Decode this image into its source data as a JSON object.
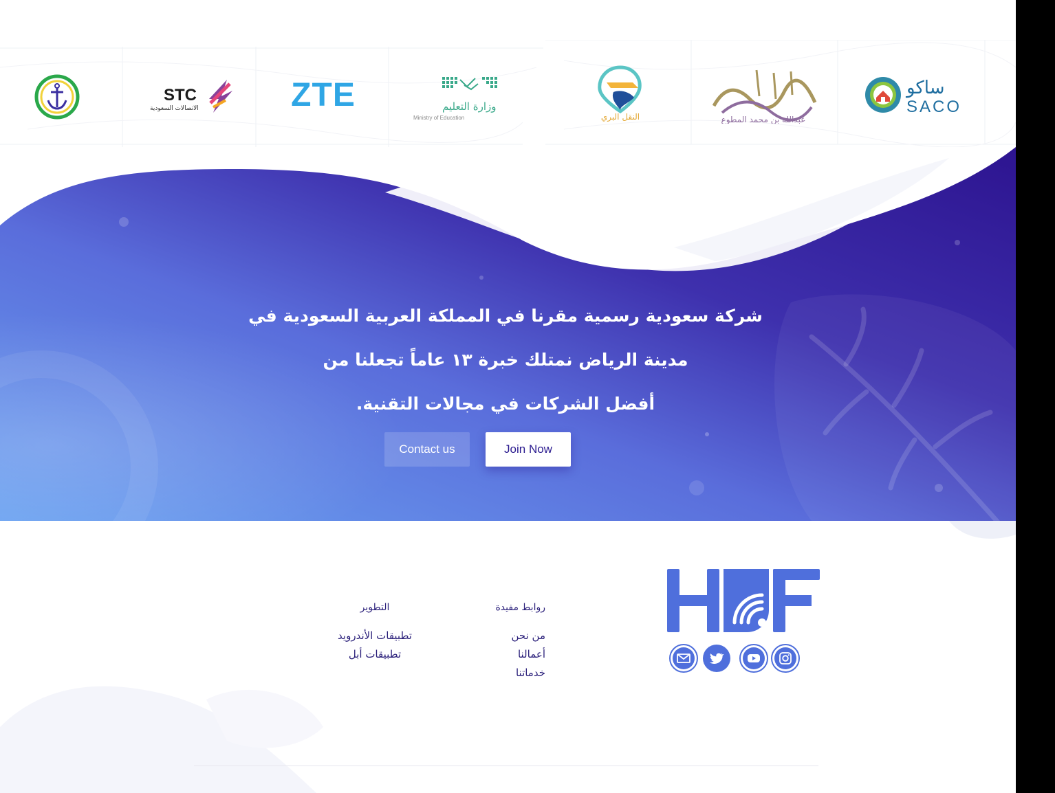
{
  "partners": {
    "logos": [
      {
        "name": "saco",
        "text_ar": "ساكو",
        "text_en": "SACO"
      },
      {
        "name": "abdullah-almutawa",
        "text_ar": "عبدالله بن محمد المطوع"
      },
      {
        "name": "land-transport",
        "text_ar": "النقل البري"
      },
      {
        "name": "ministry-of-education",
        "text_ar": "وزارة التعليم",
        "text_en": "Ministry of Education"
      },
      {
        "name": "zte",
        "text_en": "ZTE"
      },
      {
        "name": "stc",
        "text_en": "STC",
        "text_ar": "الاتصالات السعودية"
      },
      {
        "name": "maritime-anchor"
      }
    ]
  },
  "hero": {
    "line1": "شركة سعودية رسمية مقرنا في المملكة العربية السعودية في",
    "line2": "مدينة الرياض نمتلك خبرة ١٣ عاماً تجعلنا من",
    "line3": "أفضل الشركات في مجالات التقنية.",
    "contact_label": "Contact us",
    "join_label": "Join Now"
  },
  "footer": {
    "links_heading": "روابط مفيدة",
    "links": [
      "من نحن",
      "أعمالنا",
      "خدماتنا"
    ],
    "dev_heading": "التطوير",
    "dev_links": [
      "تطبيقات الأندرويد",
      "تطبيقات أبل"
    ],
    "brand_logo": "HCF",
    "social_icons": [
      "instagram-icon",
      "youtube-icon",
      "twitter-icon",
      "mail-icon"
    ]
  },
  "colors": {
    "hero_start": "#6a9ff0",
    "hero_end": "#2f1591",
    "brand_blue": "#4f6fdc",
    "footer_text": "#2a1f7a"
  }
}
